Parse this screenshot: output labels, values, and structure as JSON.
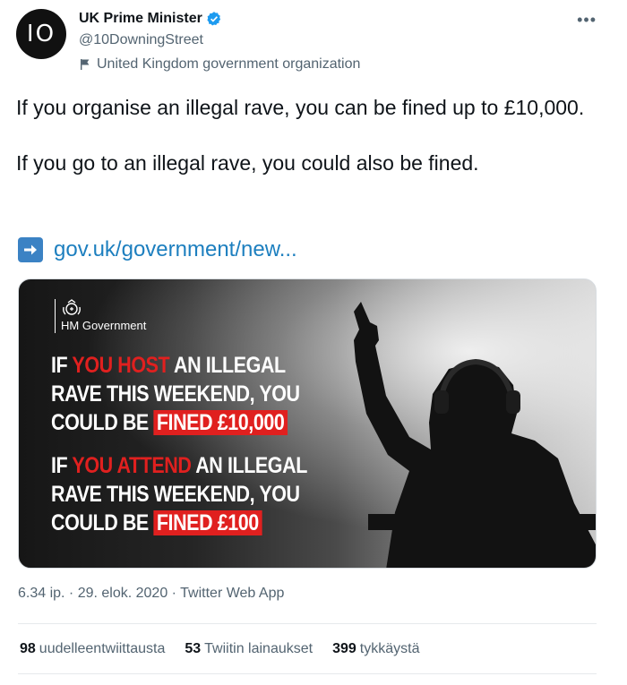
{
  "author": {
    "avatar_text": "IO",
    "display_name": "UK Prime Minister",
    "handle": "@10DowningStreet",
    "affiliation": "United Kingdom government organization"
  },
  "tweet": {
    "paragraph1": "If you organise an illegal rave, you can be fined up to £10,000.",
    "paragraph2": "If you go to an illegal rave, you could also be fined.",
    "link_text": "gov.uk/government/new..."
  },
  "media": {
    "brand": "HM Government",
    "headline1": {
      "line1_pre": "IF ",
      "line1_red": "YOU HOST",
      "line1_post": " AN ILLEGAL",
      "line2": "RAVE THIS WEEKEND, YOU",
      "line3_pre": "COULD BE ",
      "line3_box": "FINED £10,000"
    },
    "headline2": {
      "line1_pre": "IF ",
      "line1_red": "YOU ATTEND",
      "line1_post": " AN ILLEGAL",
      "line2": "RAVE THIS WEEKEND, YOU",
      "line3_pre": "COULD BE ",
      "line3_box": "FINED £100"
    }
  },
  "timestamp": "6.34 ip. · 29. elok. 2020 · Twitter Web App",
  "stats": [
    {
      "count": "98",
      "label": "uudelleentwiittausta"
    },
    {
      "count": "53",
      "label": "Twiitin lainaukset"
    },
    {
      "count": "399",
      "label": "tykkäystä"
    }
  ],
  "colors": {
    "verified": "#1d9bf0",
    "link": "#1d7fbf",
    "highlight_red": "#e0201f"
  },
  "icons": {
    "verified": "verified-badge-icon",
    "affiliation": "flag-icon",
    "more": "more-options-icon",
    "link": "arrow-right-icon"
  }
}
